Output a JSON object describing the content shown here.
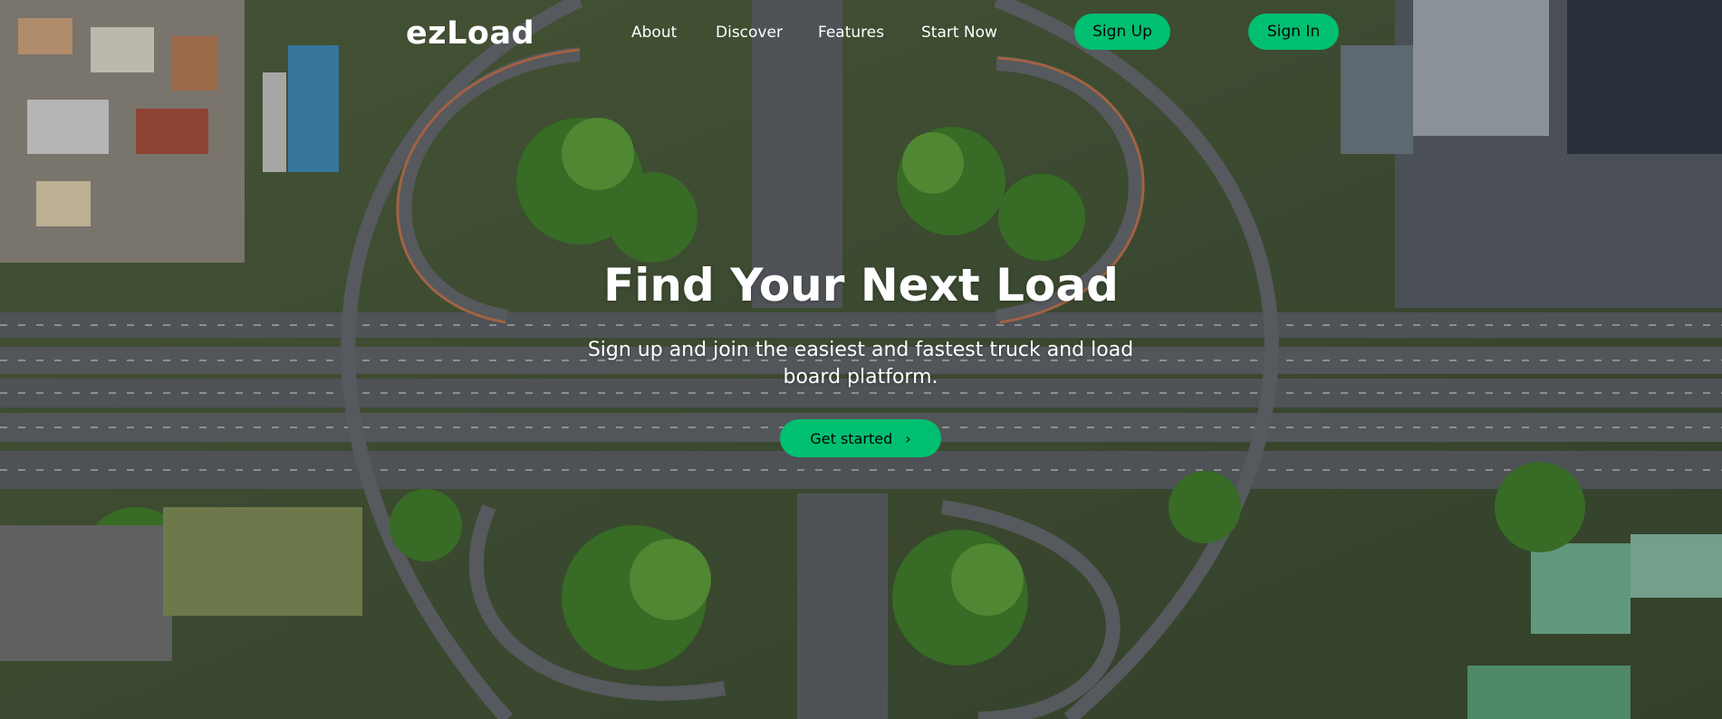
{
  "brand": {
    "logo": "ezLoad",
    "accent_color": "#01bf71",
    "text_color": "#ffffff"
  },
  "nav": {
    "links": [
      {
        "label": "About"
      },
      {
        "label": "Discover"
      },
      {
        "label": "Features"
      },
      {
        "label": "Start Now"
      }
    ],
    "signup_label": "Sign Up",
    "signin_label": "Sign In"
  },
  "hero": {
    "title": "Find Your Next Load",
    "subtitle": "Sign up and join the easiest and fastest truck and load board platform.",
    "cta_label": "Get started",
    "cta_icon": "chevron-right-icon",
    "background_image": "aerial view of highway interchange"
  }
}
